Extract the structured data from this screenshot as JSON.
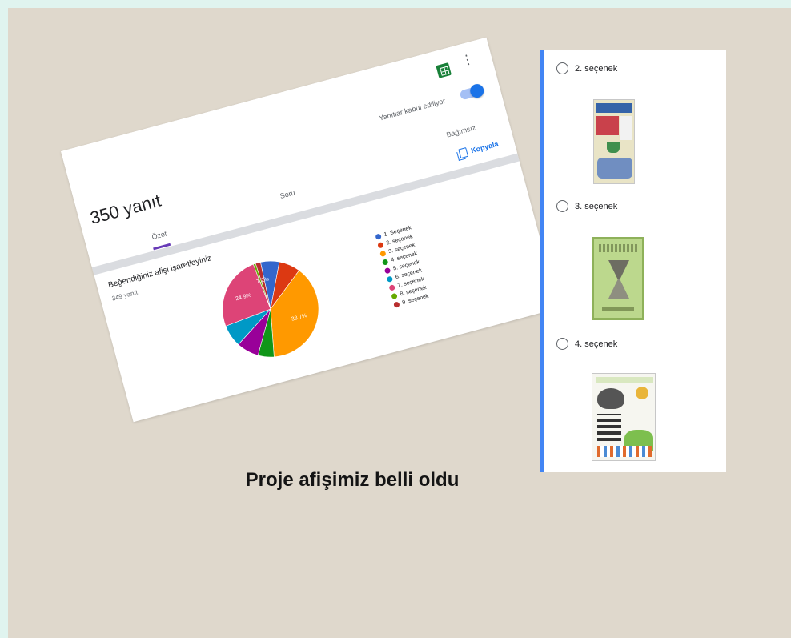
{
  "caption": "Proje afişimiz belli oldu",
  "responses": {
    "count_title": "350 yanıt",
    "accepting_label": "Yanıtlar kabul ediliyor",
    "tabs": {
      "summary": "Özet",
      "question": "Soru",
      "individual": "Bağımsız"
    },
    "copy_label": "Kopyala",
    "question_title": "Beğendiğiniz afişi işaretleyiniz",
    "question_count": "349 yanıt",
    "accent_color": "#673ab7",
    "toggle_color": "#1a73e8"
  },
  "chart_data": {
    "type": "pie",
    "title": "Beğendiğiniz afişi işaretleyiniz",
    "labels": [
      "1. Seçenek",
      "2. seçenek",
      "3. seçenek",
      "4. seçenek",
      "5. seçenek",
      "6. seçenek",
      "7. seçenek",
      "8. seçenek",
      "9. seçenek"
    ],
    "values": [
      6.3,
      7.2,
      38.7,
      5.4,
      7.5,
      7.5,
      24.9,
      0.8,
      1.7
    ],
    "colors": [
      "#3366cc",
      "#dc3912",
      "#ff9900",
      "#109618",
      "#990099",
      "#0099c6",
      "#dd4477",
      "#66aa00",
      "#b82e2e"
    ],
    "data_labels": {
      "3. seçenek": "38.7%",
      "7. seçenek": "24.9%",
      "9. seçenek": "7.2%"
    },
    "legend": "right"
  },
  "options": [
    {
      "label": "2. seçenek"
    },
    {
      "label": "3. seçenek"
    },
    {
      "label": "4. seçenek"
    }
  ],
  "options_accent": "#4285f4"
}
